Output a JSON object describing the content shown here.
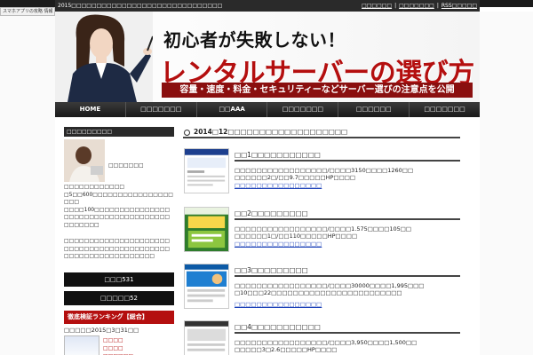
{
  "window": {
    "corner_badge": "スマホアプリの攻略 情報"
  },
  "topbar": {
    "tagline": "2015□□□□□□□□□□□□□□□□□□□□□□□□□□□□□□",
    "links": [
      "□□□□□□",
      "□□□□□□□",
      "RSS□□□□□"
    ],
    "separator": "|"
  },
  "banner": {
    "line1": "初心者が失敗しない！",
    "line2": "レンタルサーバーの選び方",
    "strip": "容量・速度・料金・セキュリティーなどサーバー選びの注意点を公開"
  },
  "nav": {
    "items": [
      "HOME",
      "□□□□□□□",
      "□□AAA",
      "□□□□□□□",
      "□□□□□□",
      "□□□□□□□"
    ]
  },
  "sidebar": {
    "profile_heading": "□□□□□□□□□",
    "profile_name": "□□□□□□□",
    "profile_lines": [
      "□□□□□□□□□□□□",
      "□5□□600□□□□□□□□□□□□□□□□□□□",
      "□□□□100□□□□□□□□□□□□□□□□□□□□□□□□□□□□□□□□□□□□□□□□□□□"
    ],
    "profile_para": "□□□□□□□□□□□□□□□□□□□□□□□□□□□□□□□□□□□□□□□□□□□□□□□□□□□□□□□□□□□□",
    "btn1": "□□□531",
    "btn2": "□□□□□52",
    "ranking_title": "徹底検証ランキング【総合】",
    "ranking_date": "□□□□□2015□3□31□□",
    "rank_labels": [
      "□□□□",
      "□□□□",
      "□□□□□□"
    ]
  },
  "main": {
    "heading": "2014□12□□□□□□□□□□□□□□□□□□□",
    "entries": [
      {
        "title": "□□1□□□□□□□□□□□",
        "desc": "□□□□□□□□□□□□□□□□□/□□□□3150□□□□1260□□\n□□□□□□2□/□□9.7□□□□□HP□□□□",
        "link": "□□□□□□□□□□□□□□□□"
      },
      {
        "title": "□□2□□□□□□□□□",
        "desc": "□□□□□□□□□□□□□□□□□/□□□□1.575□□□□105□□\n□□□□□□1□/□□110□□□□□HP□□□□",
        "link": "□□□□□□□□□□□□□□□□"
      },
      {
        "title": "□□3□□□□□□□□□",
        "desc": "□□□□□□□□□□□□□□□□□/□□□□30000□□□□1,995□□□\n□10□□□22□□□□□□□□□□□□□□□□□□□□□□□□",
        "link": "□□□□□□□□□□□□□□□□"
      },
      {
        "title": "□□4□□□□□□□□□□□",
        "desc": "□□□□□□□□□□□□□□□□□/□□□□3,950□□□□1,500□□\n□□□□□3□2.6□□□□□HP□□□□",
        "link": ""
      }
    ]
  },
  "colors": {
    "brand_red": "#b40f0f",
    "nav_dark": "#2a2a2a",
    "link_blue": "#1a3fb8"
  }
}
